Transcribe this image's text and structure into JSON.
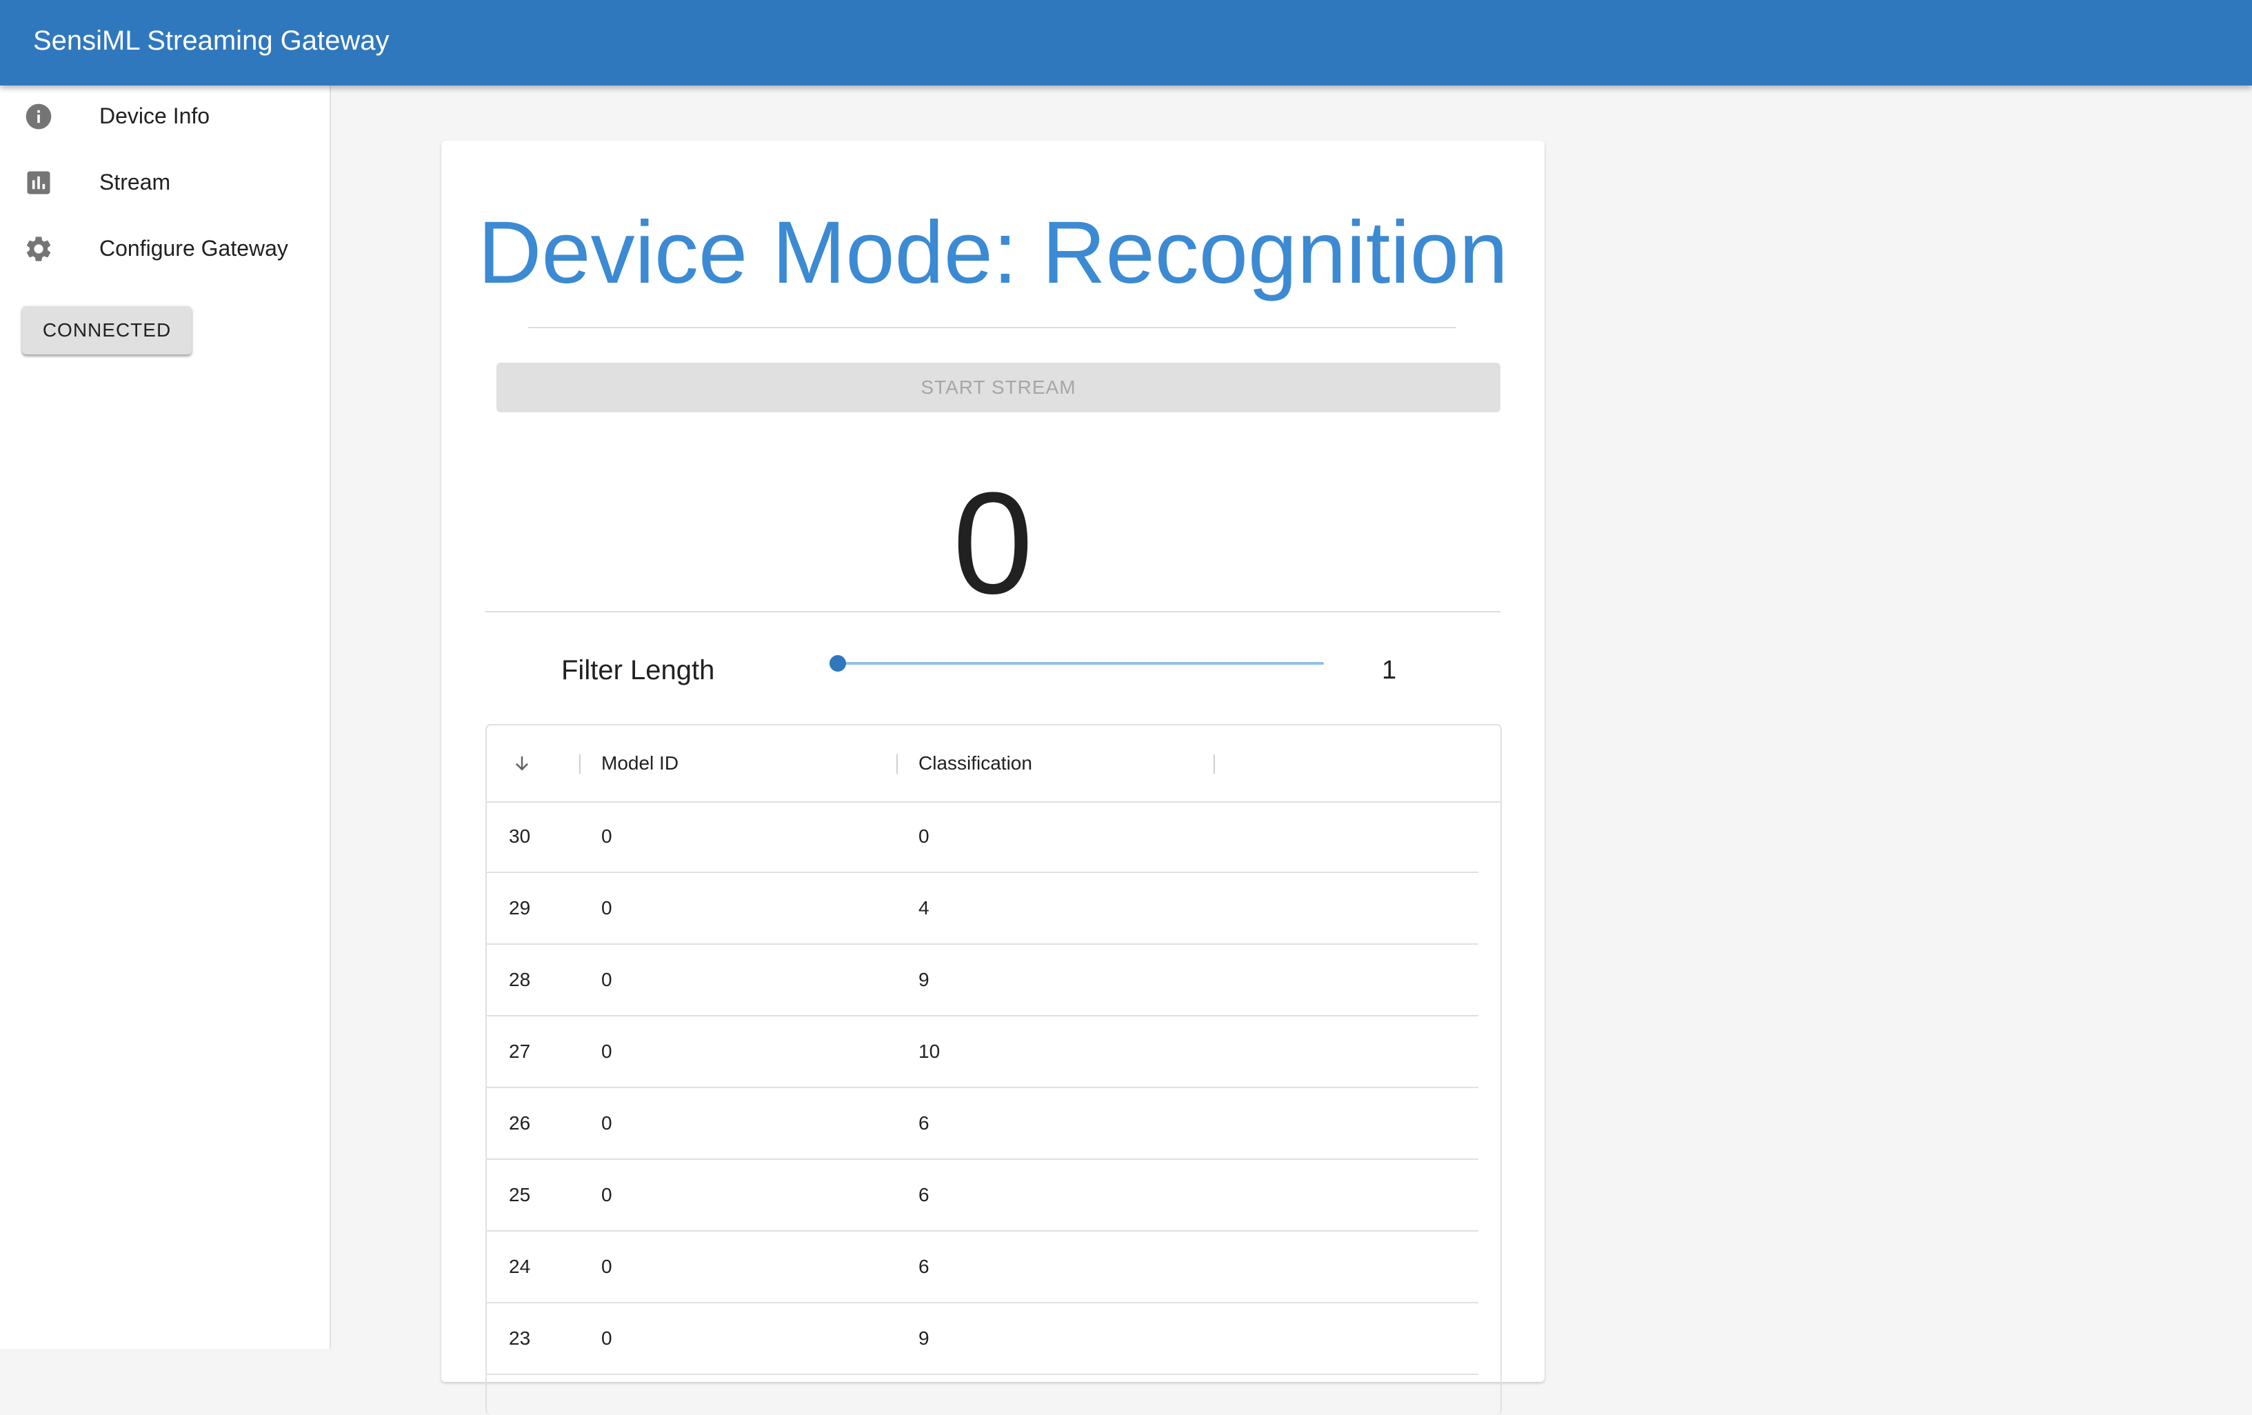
{
  "app": {
    "title": "SensiML Streaming Gateway",
    "accent": "#3078bd"
  },
  "sidebar": {
    "items": [
      {
        "label": "Device Info",
        "icon": "info-icon"
      },
      {
        "label": "Stream",
        "icon": "bar-chart-icon"
      },
      {
        "label": "Configure Gateway",
        "icon": "gear-icon"
      }
    ],
    "connection_label": "CONNECTED"
  },
  "main": {
    "mode_title": "Device Mode: Recognition",
    "start_stream_label": "START STREAM",
    "current_classification": "0",
    "filter": {
      "label": "Filter Length",
      "value": "1"
    }
  },
  "table": {
    "sort_icon": "arrow-down-icon",
    "columns": [
      "Model ID",
      "Classification"
    ],
    "rows": [
      {
        "id": "30",
        "model_id": "0",
        "classification": "0"
      },
      {
        "id": "29",
        "model_id": "0",
        "classification": "4"
      },
      {
        "id": "28",
        "model_id": "0",
        "classification": "9"
      },
      {
        "id": "27",
        "model_id": "0",
        "classification": "10"
      },
      {
        "id": "26",
        "model_id": "0",
        "classification": "6"
      },
      {
        "id": "25",
        "model_id": "0",
        "classification": "6"
      },
      {
        "id": "24",
        "model_id": "0",
        "classification": "6"
      },
      {
        "id": "23",
        "model_id": "0",
        "classification": "9"
      }
    ]
  }
}
